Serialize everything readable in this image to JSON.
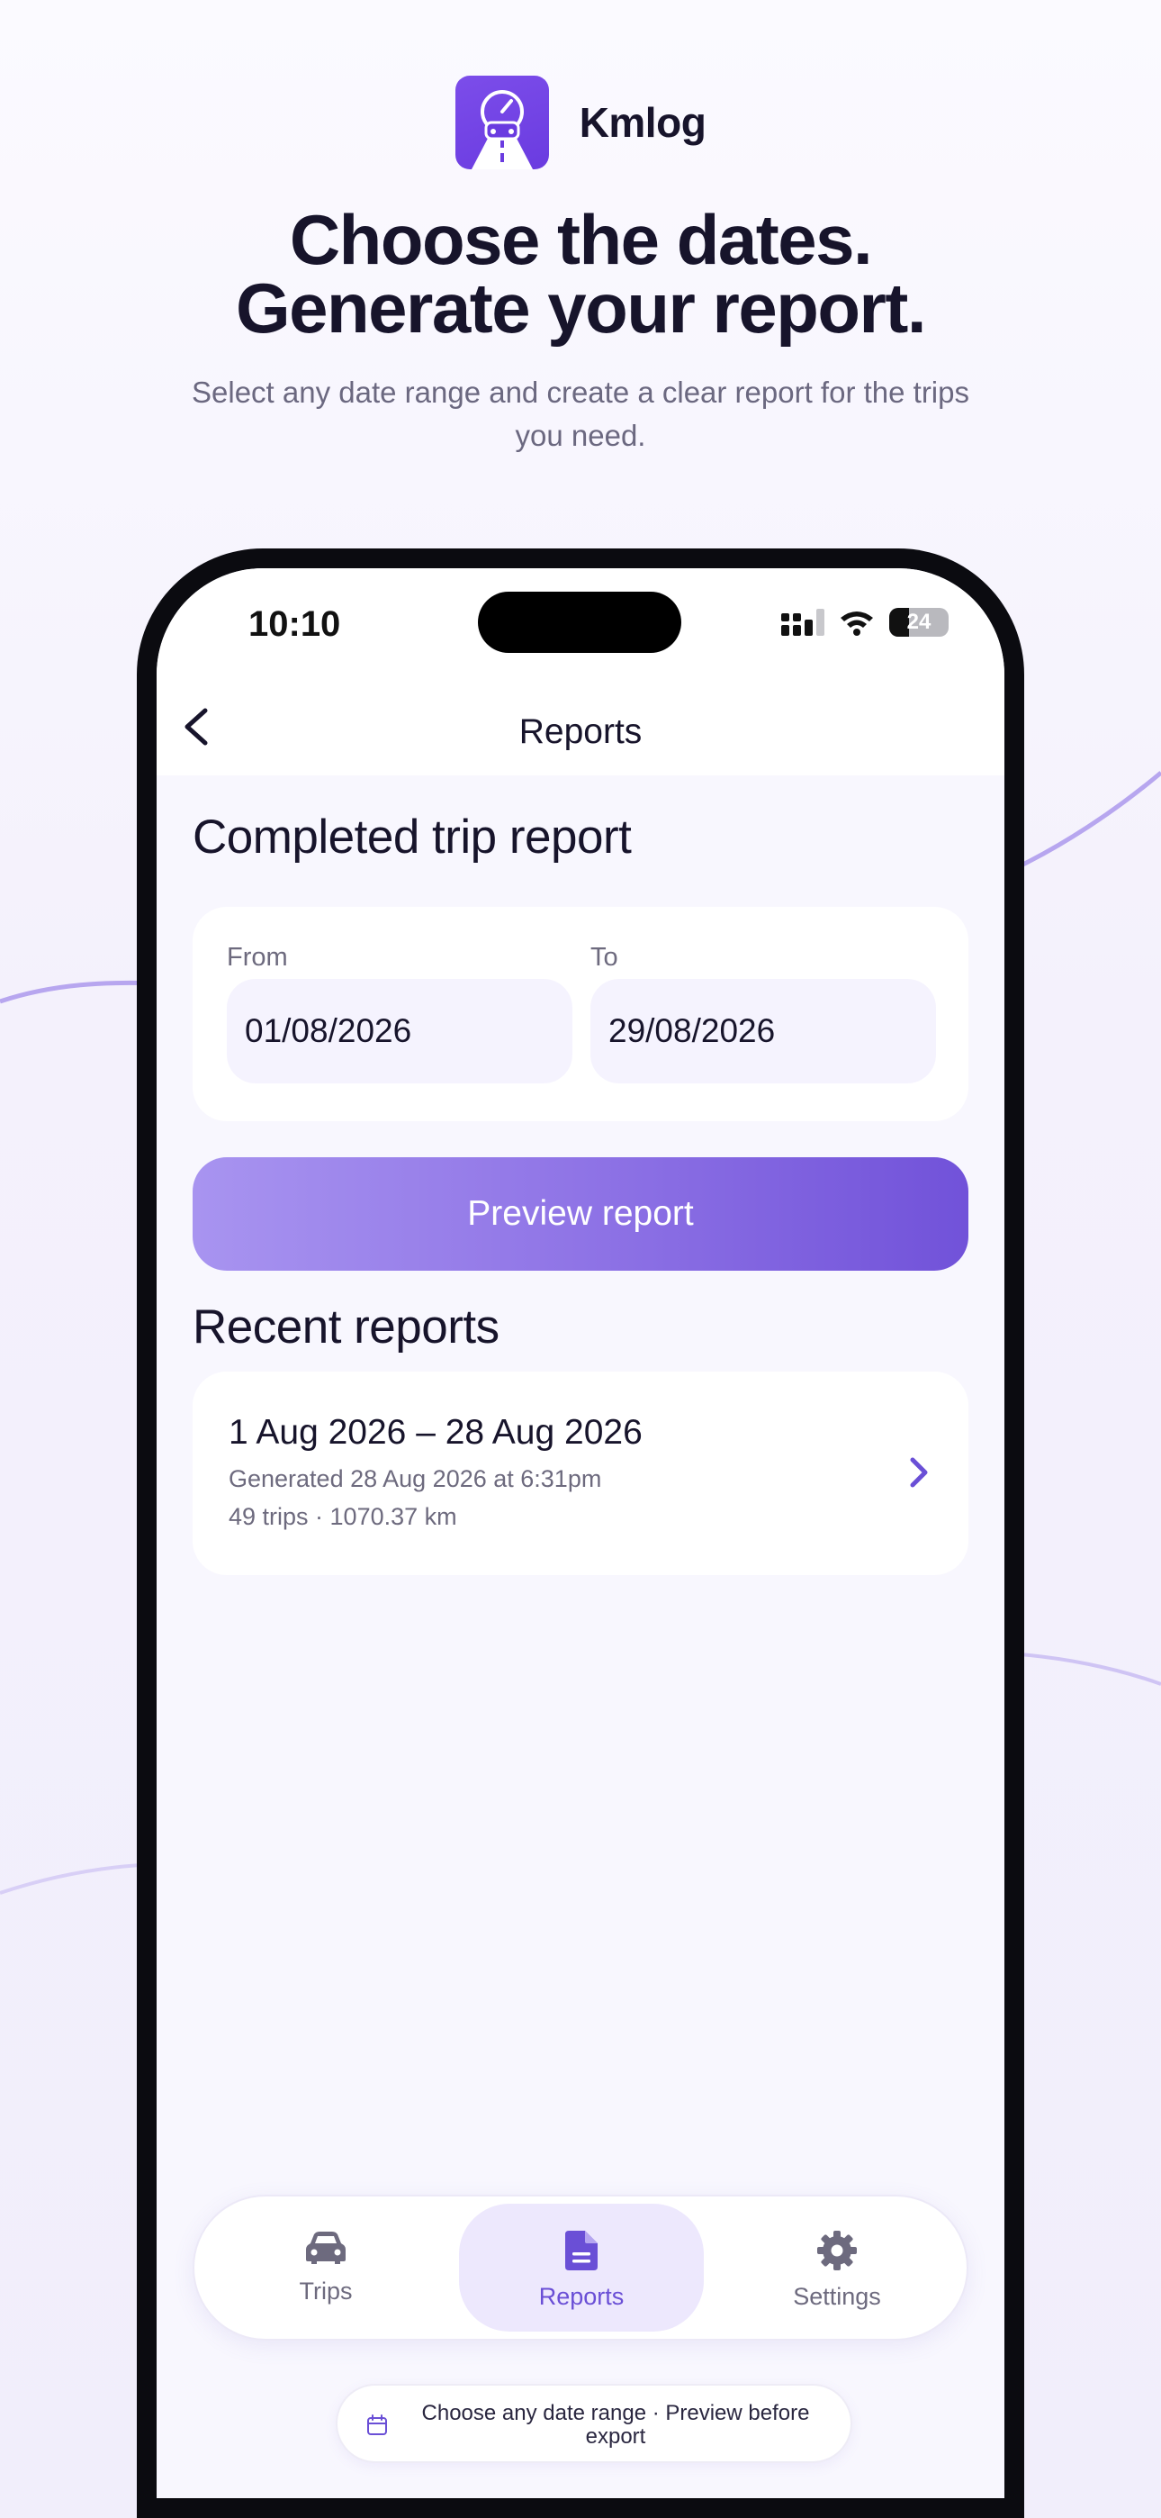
{
  "brand": {
    "name": "Kmlog",
    "accent": "#6a3be0"
  },
  "headline": {
    "line1": "Choose the dates.",
    "line2": "Generate your report."
  },
  "subheadline": "Select any date range and create a clear report for the trips you need.",
  "status_bar": {
    "time": "10:10",
    "battery": "24"
  },
  "nav": {
    "title": "Reports",
    "back_icon": "chevron-left-icon"
  },
  "completed": {
    "title": "Completed trip report",
    "from_label": "From",
    "from_value": "01/08/2026",
    "to_label": "To",
    "to_value": "29/08/2026",
    "preview_button": "Preview report"
  },
  "recent": {
    "title": "Recent reports",
    "items": [
      {
        "range": "1 Aug 2026 – 28 Aug 2026",
        "generated": "Generated 28 Aug 2026 at 6:31pm",
        "summary": "49 trips · 1070.37 km"
      }
    ]
  },
  "tabs": [
    {
      "label": "Trips",
      "icon": "car-icon",
      "active": false
    },
    {
      "label": "Reports",
      "icon": "document-icon",
      "active": true
    },
    {
      "label": "Settings",
      "icon": "gear-icon",
      "active": false
    }
  ],
  "hint": {
    "icon": "calendar-icon",
    "text": "Choose any date range · Preview before export"
  }
}
